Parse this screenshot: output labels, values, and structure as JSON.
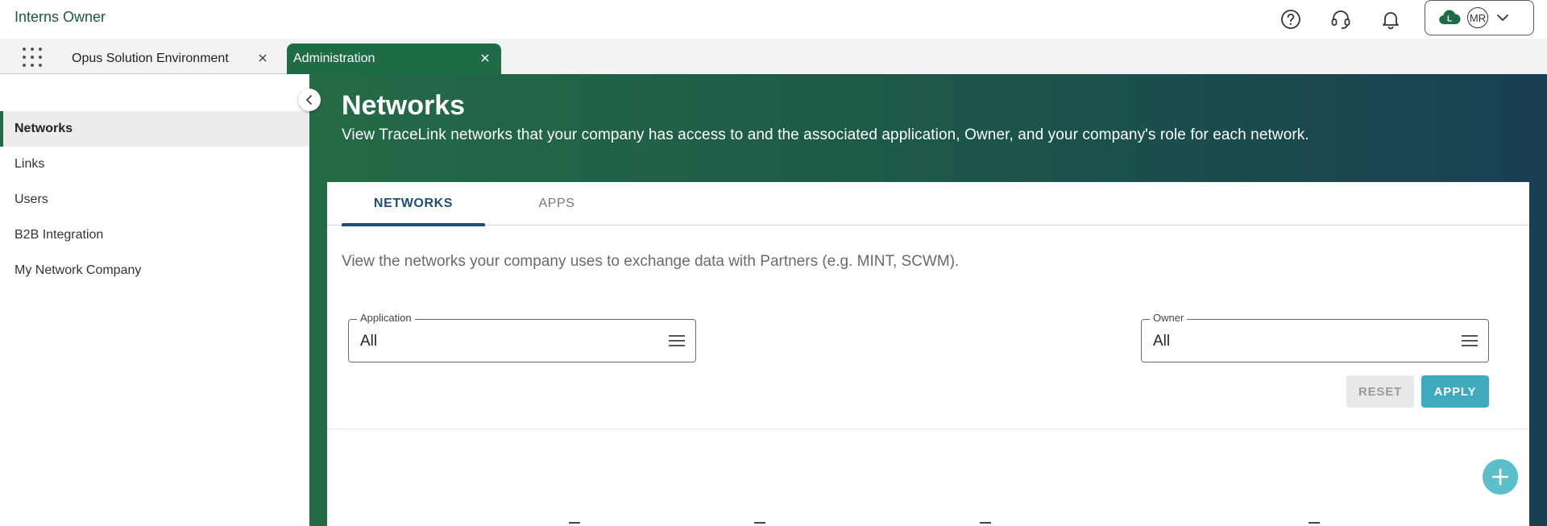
{
  "header": {
    "app_title": "Interns Owner",
    "icons": [
      "help-icon",
      "support-headset-icon",
      "notification-bell-icon"
    ],
    "profile": {
      "cloud_letter": "L",
      "avatar_initials": "MR"
    }
  },
  "tabs": [
    {
      "label": "Opus Solution Environment",
      "active": false
    },
    {
      "label": "Administration",
      "active": true
    }
  ],
  "sidebar": {
    "items": [
      {
        "label": "Networks",
        "active": true
      },
      {
        "label": "Links",
        "active": false
      },
      {
        "label": "Users",
        "active": false
      },
      {
        "label": "B2B Integration",
        "active": false
      },
      {
        "label": "My Network Company",
        "active": false
      }
    ]
  },
  "page": {
    "title": "Networks",
    "description": "View TraceLink networks that your company has access to and the associated application, Owner, and your company's role for each network."
  },
  "card": {
    "tabs": [
      {
        "label": "NETWORKS",
        "active": true
      },
      {
        "label": "APPS",
        "active": false
      }
    ],
    "description": "View the networks your company uses to exchange data with Partners (e.g. MINT, SCWM).",
    "filters": {
      "application": {
        "label": "Application",
        "value": "All"
      },
      "owner": {
        "label": "Owner",
        "value": "All"
      }
    },
    "buttons": {
      "reset": "RESET",
      "apply": "APPLY"
    }
  },
  "colors": {
    "brand_green": "#1f6b45",
    "header_gradient_end": "#183f52",
    "accent_blue": "#1d4f7a",
    "apply_button": "#3fa9bd",
    "fab": "#5bbec9"
  }
}
